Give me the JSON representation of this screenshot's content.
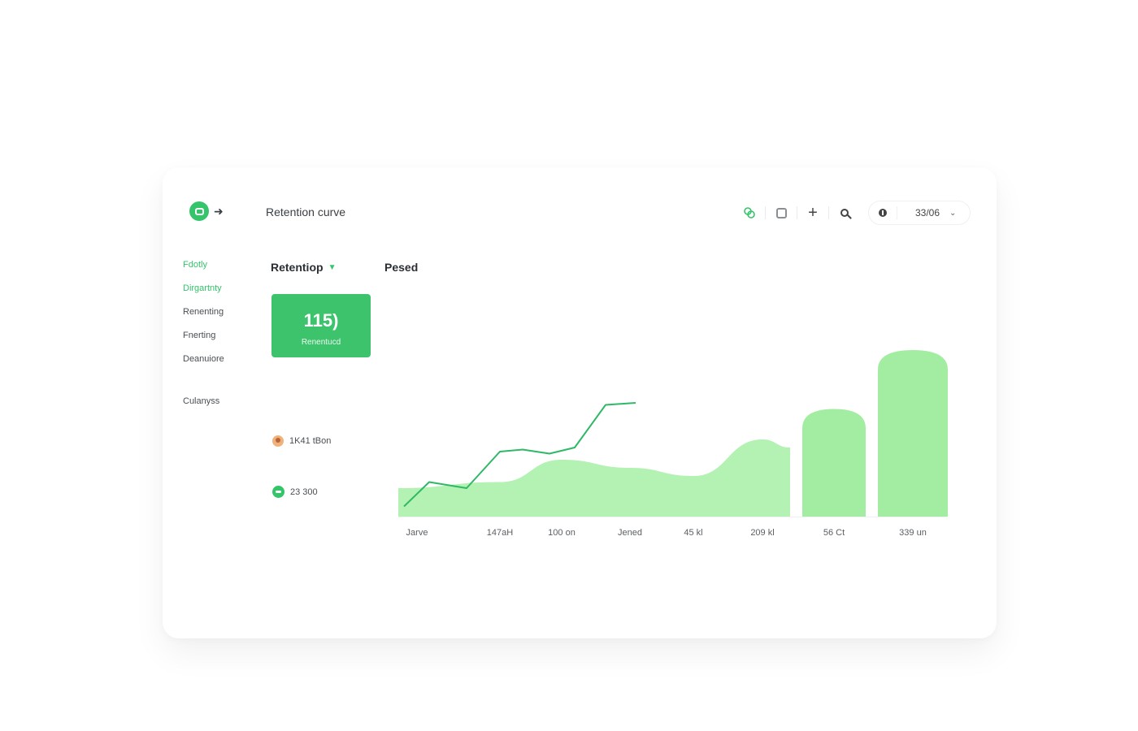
{
  "header": {
    "title": "Retention curve",
    "date_value": "33/06"
  },
  "icons": {
    "logo": "app-logo-icon",
    "toolbar": [
      "link-icon",
      "calendar-icon",
      "plus-icon",
      "search-icon",
      "info-icon",
      "chevron-down-icon"
    ]
  },
  "colors": {
    "accent": "#34c46a",
    "area": "#b3f2b3",
    "bar": "#a3eda3",
    "line": "#2fb866"
  },
  "sidebar": {
    "items": [
      {
        "label": "Fdotly",
        "active": true
      },
      {
        "label": "Dirgartnty",
        "active": true
      },
      {
        "label": "Renenting",
        "active": false
      },
      {
        "label": "Fnerting",
        "active": false
      },
      {
        "label": "Deanuiore",
        "active": false
      }
    ],
    "footer_item": "Culanyss"
  },
  "main": {
    "metric_selector": "Retentiop",
    "period_label": "Pesed",
    "kpi": {
      "value": "115)",
      "label": "Renentucd"
    },
    "legend": [
      {
        "label": "1K41 tBon",
        "icon": "avatar-icon"
      },
      {
        "label": "23 300",
        "icon": "chat-icon"
      }
    ]
  },
  "chart_data": {
    "type": "area",
    "categories": [
      "Jarve",
      "147aH",
      "100 on",
      "Jened",
      "45 kl",
      "209 kl",
      "56 Ct",
      "339 un"
    ],
    "series": [
      {
        "kind": "line",
        "values": [
          8,
          17,
          14,
          32,
          31,
          34,
          55,
          56
        ]
      },
      {
        "kind": "area",
        "values": [
          14,
          17,
          28,
          24,
          20,
          38,
          40,
          0
        ]
      },
      {
        "kind": "bar",
        "values": [
          0,
          0,
          0,
          0,
          0,
          0,
          53,
          82
        ]
      }
    ],
    "ylim": [
      0,
      100
    ],
    "grid": false
  }
}
